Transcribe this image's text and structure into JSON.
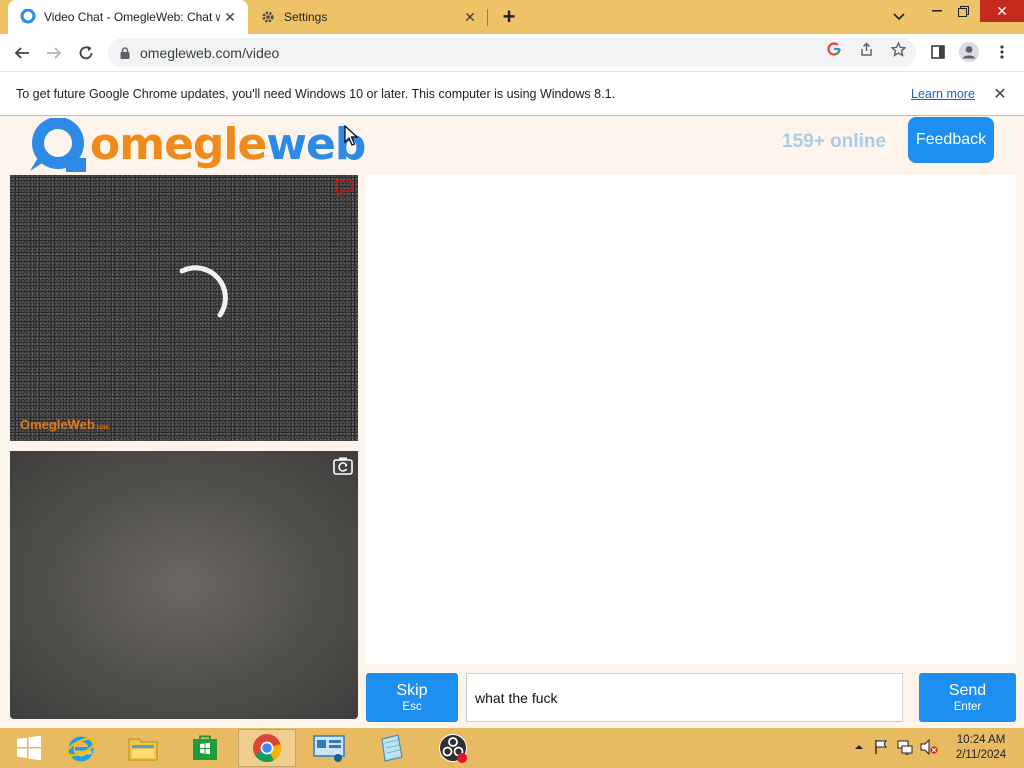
{
  "browser": {
    "tabs": [
      {
        "title": "Video Chat - OmegleWeb: Chat with Strangers",
        "favicon": "omegleweb-favicon-icon",
        "active": true
      },
      {
        "title": "Settings",
        "favicon": "gear-icon",
        "active": false
      }
    ],
    "url": "omegleweb.com/video",
    "infobar": {
      "message": "To get future Google Chrome updates, you'll need Windows 10 or later. This computer is using Windows 8.1.",
      "link": "Learn more"
    }
  },
  "site": {
    "logo_part1": "omegle",
    "logo_part2": "web",
    "online_count": "159+ online",
    "feedback_label": "Feedback",
    "watermark": "OmegleWeb",
    "watermark_suffix": ".com",
    "controls": {
      "skip_label": "Skip",
      "skip_hint": "Esc",
      "message_value": "what the fuck",
      "send_label": "Send",
      "send_hint": "Enter"
    }
  },
  "taskbar": {
    "items": [
      "start-button",
      "internet-explorer",
      "file-explorer",
      "store",
      "chrome",
      "remote-desktop",
      "notepad-app",
      "obs-studio"
    ],
    "clock": {
      "time": "10:24 AM",
      "date": "2/11/2024"
    }
  },
  "colors": {
    "accent": "#1d8ff0",
    "logo_orange": "#f08a1a",
    "logo_blue": "#2d8ae6",
    "tabbar": "#eec368",
    "taskbar": "#e8bb63"
  }
}
